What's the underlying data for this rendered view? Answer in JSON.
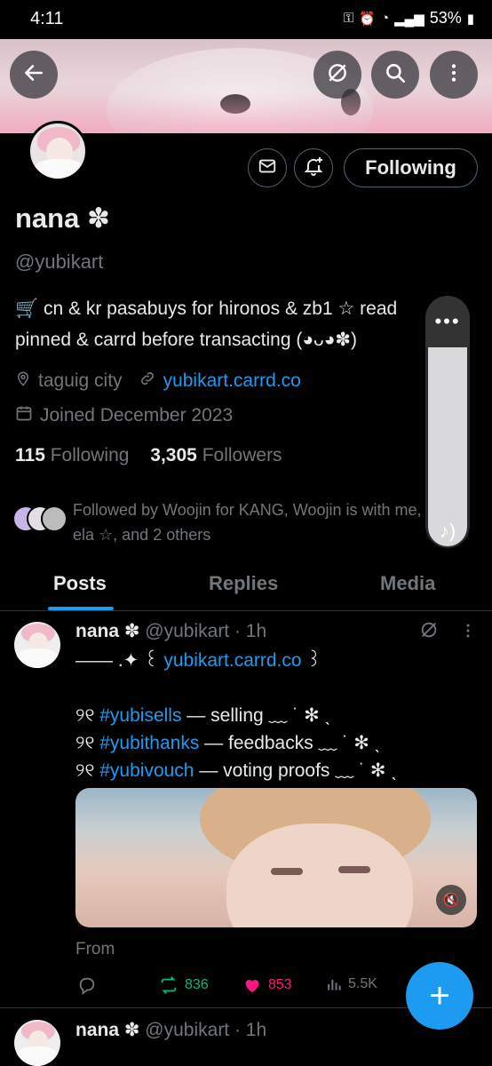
{
  "status_bar": {
    "time": "4:11",
    "battery": "53%"
  },
  "profile": {
    "name": "nana ✽",
    "handle": "@yubikart",
    "bio": "🛒 cn & kr pasabuys for hironos & zb1 ☆ read pinned & carrd before transacting (◕ᴗ◕✽)",
    "location": "taguig city",
    "website": "yubikart.carrd.co",
    "joined": "Joined December 2023",
    "following_count": "115",
    "following_label": "Following",
    "followers_count": "3,305",
    "followers_label": "Followers",
    "followed_by": "Followed by Woojin for KANG, Woojin is with me, ela ☆, and 2 others",
    "follow_button": "Following"
  },
  "tabs": [
    {
      "label": "Posts",
      "active": true
    },
    {
      "label": "Replies",
      "active": false
    },
    {
      "label": "Media",
      "active": false
    }
  ],
  "posts": [
    {
      "name": "nana ✽",
      "handle": "@yubikart · 1h",
      "line1_prefix": "——  .✦ ꒰ ",
      "line1_link": "yubikart.carrd.co",
      "line1_suffix": " ꒱",
      "items": [
        {
          "bullet": "୨୧",
          "tag": "#yubisells",
          "text": " — selling ﹏ ˙ ✻ ˎ"
        },
        {
          "bullet": "୨୧",
          "tag": "#yubithanks",
          "text": " — feedbacks ﹏ ˙ ✻ ˎ"
        },
        {
          "bullet": "୨୧",
          "tag": "#yubivouch",
          "text": " — voting proofs ﹏ ˙ ✻ ˎ"
        }
      ],
      "from": "From",
      "retweets": "836",
      "likes": "853",
      "views": "5.5K"
    },
    {
      "name": "nana ✽",
      "handle": "@yubikart · 1h"
    }
  ],
  "colors": {
    "accent": "#1d9bf0",
    "retweet": "#00ba7c",
    "like": "#f91880",
    "muted": "#71767b"
  }
}
